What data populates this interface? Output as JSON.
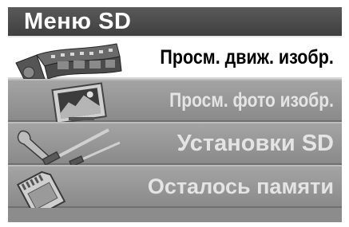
{
  "menu": {
    "title": "Меню SD",
    "items": [
      {
        "label": "Просм. движ. изобр.",
        "icon": "film-reel-icon",
        "selected": true
      },
      {
        "label": "Просм. фото изобр.",
        "icon": "photo-frame-icon",
        "selected": false
      },
      {
        "label": "Установки SD",
        "icon": "tools-icon",
        "selected": false
      },
      {
        "label": "Осталось памяти",
        "icon": "sd-card-icon",
        "selected": false
      }
    ]
  },
  "colors": {
    "title_bar": "#4a4a4a",
    "selected_bg": "#ffffff",
    "item_bg": "#9a9a9a",
    "selected_text": "#000000",
    "item_text": "#e4e4e4"
  }
}
